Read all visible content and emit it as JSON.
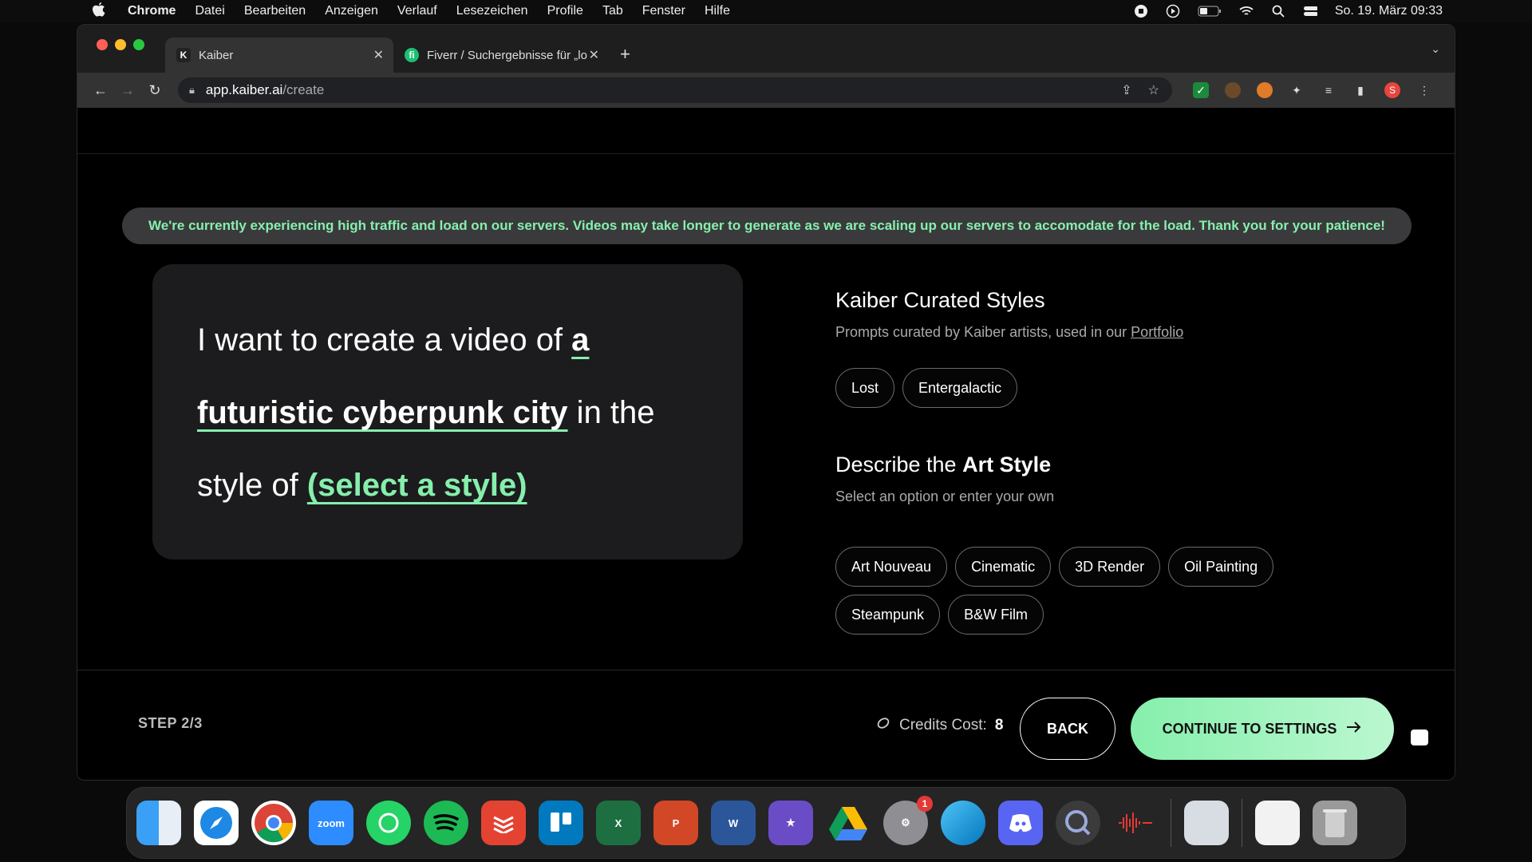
{
  "menubar": {
    "app_name": "Chrome",
    "items": [
      "Datei",
      "Bearbeiten",
      "Anzeigen",
      "Verlauf",
      "Lesezeichen",
      "Profile",
      "Tab",
      "Fenster",
      "Hilfe"
    ],
    "datetime": "So. 19. März  09:33"
  },
  "browser": {
    "tabs": [
      {
        "title": "Kaiber",
        "favicon": "K"
      },
      {
        "title": "Fiverr / Suchergebnisse für „lo",
        "favicon": "fi"
      }
    ],
    "url_host": "app.kaiber.ai",
    "url_path": "/create",
    "profile_initial": "S"
  },
  "banner": {
    "text": "We're currently experiencing high traffic and load on our servers. Videos may take longer to generate as we are scaling up our servers to accomodate for the load. Thank you for your patience!"
  },
  "prompt": {
    "prefix": "I want to create a video of ",
    "subject": "a futuristic cyberpunk city",
    "middle": " in the style of ",
    "style_placeholder": "(select a style)"
  },
  "curated": {
    "title": "Kaiber Curated Styles",
    "subtitle": "Prompts curated by Kaiber artists, used in our ",
    "link": "Portfolio",
    "chips": [
      "Lost",
      "Entergalactic"
    ]
  },
  "art_style": {
    "title_prefix": "Describe the ",
    "title_bold": "Art Style",
    "subtitle": "Select an option or enter your own",
    "chips": [
      "Art Nouveau",
      "Cinematic",
      "3D Render",
      "Oil Painting",
      "Steampunk",
      "B&W Film"
    ]
  },
  "footer": {
    "step": "STEP 2/3",
    "credits_label": "Credits Cost: ",
    "credits_value": "8",
    "back_label": "BACK",
    "continue_label": "CONTINUE TO SETTINGS"
  },
  "dock": {
    "zoom_label": "zoom",
    "settings_badge": "1"
  },
  "colors": {
    "accent": "#86efac",
    "card": "#1c1c1e",
    "banner_bg": "#3a3a3c"
  }
}
